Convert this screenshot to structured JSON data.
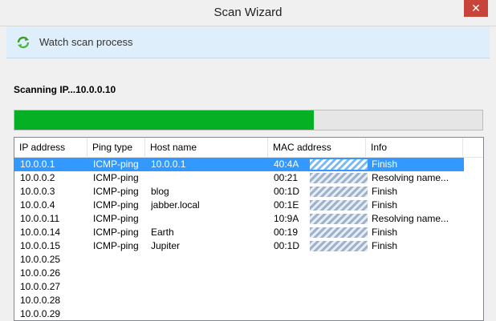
{
  "window": {
    "title": "Scan Wizard",
    "close_glyph": "✕"
  },
  "header": {
    "text": "Watch scan process",
    "icon": "refresh-icon"
  },
  "scan": {
    "status": "Scanning IP...10.0.0.10",
    "progress_fraction": 0.64,
    "progress_color": "#06b025"
  },
  "table": {
    "columns": [
      "IP address",
      "Ping type",
      "Host name",
      "MAC address",
      "Info"
    ],
    "rows": [
      {
        "ip": "10.0.0.1",
        "ping": "ICMP-ping",
        "host": "10.0.0.1",
        "mac": "40:4A",
        "info": "Finish"
      },
      {
        "ip": "10.0.0.2",
        "ping": "ICMP-ping",
        "host": "",
        "mac": "00:21",
        "info": "Resolving name..."
      },
      {
        "ip": "10.0.0.3",
        "ping": "ICMP-ping",
        "host": "blog",
        "mac": "00:1D",
        "info": "Finish"
      },
      {
        "ip": "10.0.0.4",
        "ping": "ICMP-ping",
        "host": "jabber.local",
        "mac": "00:1E",
        "info": "Finish"
      },
      {
        "ip": "10.0.0.11",
        "ping": "ICMP-ping",
        "host": "",
        "mac": "10:9A",
        "info": "Resolving name..."
      },
      {
        "ip": "10.0.0.14",
        "ping": "ICMP-ping",
        "host": "Earth",
        "mac": "00:19",
        "info": "Finish"
      },
      {
        "ip": "10.0.0.15",
        "ping": "ICMP-ping",
        "host": "Jupiter",
        "mac": "00:1D",
        "info": "Finish"
      },
      {
        "ip": "10.0.0.25",
        "ping": "",
        "host": "",
        "mac": "",
        "info": ""
      },
      {
        "ip": "10.0.0.26",
        "ping": "",
        "host": "",
        "mac": "",
        "info": ""
      },
      {
        "ip": "10.0.0.27",
        "ping": "",
        "host": "",
        "mac": "",
        "info": ""
      },
      {
        "ip": "10.0.0.28",
        "ping": "",
        "host": "",
        "mac": "",
        "info": ""
      },
      {
        "ip": "10.0.0.29",
        "ping": "",
        "host": "",
        "mac": "",
        "info": ""
      }
    ]
  }
}
